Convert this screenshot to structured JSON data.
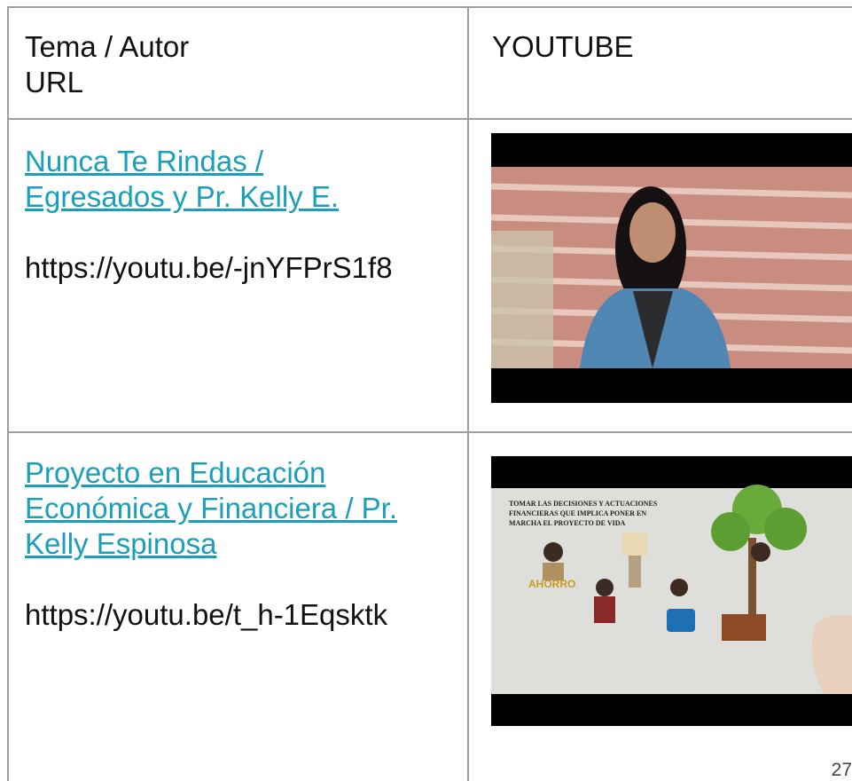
{
  "table": {
    "header": {
      "col1": "Tema / Autor",
      "col1_sub": "URL",
      "col2": "YOUTUBE"
    },
    "rows": [
      {
        "title_link_line1": "Nunca Te Rindas /",
        "title_link_line2": "Egresados y Pr. Kelly E.",
        "url": "https://youtu.be/-jnYFPrS1f8",
        "video_thumbnail": "video-thumbnail-woman-denim-jacket"
      },
      {
        "title_link_line1": "Proyecto en Educación",
        "title_link_line2": "Económica y Financiera / Pr.",
        "title_link_line3": "Kelly Espinosa",
        "url": "https://youtu.be/t_h-1Eqsktk",
        "video_thumbnail": "video-thumbnail-whiteboard-animation",
        "thumbnail_caption_line1": "TOMAR LAS DECISIONES Y ACTUACIONES",
        "thumbnail_caption_line2": "FINANCIERAS QUE IMPLICA PONER EN",
        "thumbnail_caption_line3": "MARCHA EL PROYECTO DE VIDA",
        "thumbnail_label": "AHORRO"
      }
    ]
  },
  "page_number": "27",
  "colors": {
    "link": "#1a9fba",
    "border": "#9e9e9e"
  }
}
